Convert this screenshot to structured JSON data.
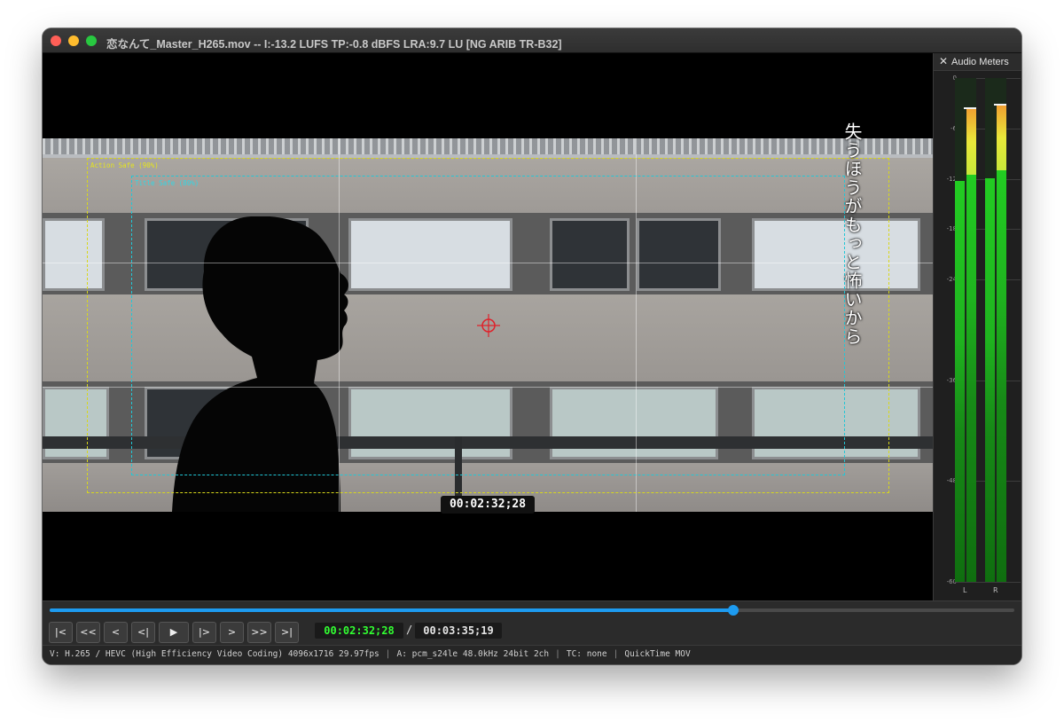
{
  "window": {
    "title": "恋なんて_Master_H265.mov -- I:-13.2 LUFS  TP:-0.8 dBFS  LRA:9.7 LU  [NG ARIB TR-B32]"
  },
  "viewer": {
    "subtitle": "失うほうがもっと怖いから",
    "timecode_overlay": "00:02:32;28",
    "action_safe_label": "Action Safe (90%)",
    "title_safe_label": "Title Safe (80%)"
  },
  "meters": {
    "title": "Audio Meters",
    "close_icon": "close-icon",
    "scale": [
      "0",
      "-6",
      "-12",
      "-18",
      "-24",
      "-36",
      "-48",
      "-60"
    ],
    "scale_db": [
      0,
      -6,
      -12,
      -18,
      -24,
      -36,
      -48,
      -60
    ],
    "channels": [
      {
        "label": "L",
        "rms_db": -12.3,
        "peak_db": -11.5,
        "peak_hold_db": -3.7
      },
      {
        "label": "R",
        "rms_db": -11.9,
        "peak_db": -11.0,
        "peak_hold_db": -3.3
      }
    ]
  },
  "transport": {
    "buttons": [
      {
        "label": "|<",
        "icon": "go-to-start-icon"
      },
      {
        "label": "<<",
        "icon": "rewind-icon"
      },
      {
        "label": "<",
        "icon": "step-back-icon"
      },
      {
        "label": "<|",
        "icon": "previous-frame-icon"
      },
      {
        "label": "▶",
        "icon": "play-icon"
      },
      {
        "label": "|>",
        "icon": "next-frame-icon"
      },
      {
        "label": ">",
        "icon": "step-forward-icon"
      },
      {
        "label": ">>",
        "icon": "fast-forward-icon"
      },
      {
        "label": ">|",
        "icon": "go-to-end-icon"
      }
    ],
    "current_timecode": "00:02:32;28",
    "separator": "/",
    "total_timecode": "00:03:35;19",
    "progress": 0.709
  },
  "status": {
    "video": "V: H.265 / HEVC (High Efficiency Video Coding) 4096x1716 29.97fps",
    "audio": "A: pcm_s24le 48.0kHz 24bit 2ch",
    "tc": "TC: none",
    "container": "QuickTime MOV",
    "separator": "|"
  },
  "colors": {
    "timecode_green": "#32ff32",
    "scrub_blue": "#1d9bf0",
    "action_safe": "#d8d81a",
    "title_safe": "#21c7d6",
    "crosshair": "#e0202a",
    "meter_green": "#22cc22",
    "meter_yellow": "#e8e83a",
    "meter_orange": "#f0a030"
  }
}
